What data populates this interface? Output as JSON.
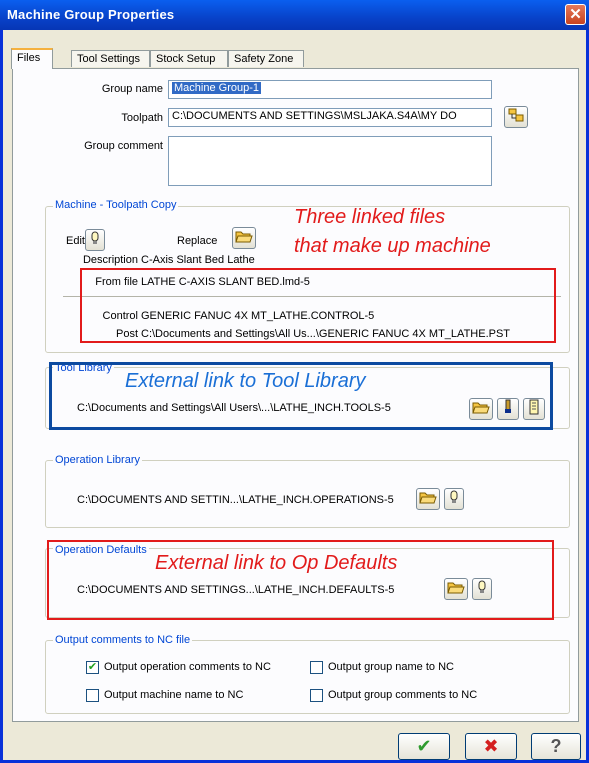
{
  "window": {
    "title": "Machine Group Properties",
    "close_glyph": "✕"
  },
  "tabs": [
    "Files",
    "Tool Settings",
    "Stock Setup",
    "Safety Zone"
  ],
  "form": {
    "group_name_label": "Group name",
    "group_name_value": "Machine Group-1",
    "toolpath_label": "Toolpath",
    "toolpath_value": "C:\\DOCUMENTS AND SETTINGS\\MSLJAKA.S4A\\MY DO",
    "group_comment_label": "Group comment",
    "group_comment_value": ""
  },
  "machine_toolpath": {
    "title": "Machine - Toolpath Copy",
    "edit_label": "Edit",
    "replace_label": "Replace",
    "description_label": "Description",
    "description_value": "C-Axis Slant Bed Lathe",
    "from_file_label": "From file",
    "from_file_value": "LATHE C-AXIS SLANT BED.lmd-5",
    "control_label": "Control",
    "control_value": "GENERIC FANUC 4X MT_LATHE.CONTROL-5",
    "post_label": "Post",
    "post_value": "C:\\Documents and Settings\\All Us...\\GENERIC FANUC 4X MT_LATHE.PST"
  },
  "tool_library": {
    "title": "Tool Library",
    "path": "C:\\Documents and Settings\\All Users\\...\\LATHE_INCH.TOOLS-5"
  },
  "operation_library": {
    "title": "Operation Library",
    "path": "C:\\DOCUMENTS AND SETTIN...\\LATHE_INCH.OPERATIONS-5"
  },
  "operation_defaults": {
    "title": "Operation Defaults",
    "path": "C:\\DOCUMENTS AND SETTINGS...\\LATHE_INCH.DEFAULTS-5"
  },
  "output_comments": {
    "title": "Output comments to NC file",
    "options": [
      {
        "label": "Output operation comments to NC",
        "checked": true
      },
      {
        "label": "Output group name to NC",
        "checked": false
      },
      {
        "label": "Output machine name to NC",
        "checked": false
      },
      {
        "label": "Output group comments to NC",
        "checked": false
      }
    ]
  },
  "annotations": {
    "machine_line1": "Three linked files",
    "machine_line2": "that make up machine",
    "tool_library": "External link to Tool Library",
    "op_defaults": "External link to Op Defaults"
  },
  "footer": {
    "ok_glyph": "✔",
    "cancel_glyph": "✖",
    "help_glyph": "?"
  },
  "colors": {
    "title_bar": "#0842C9",
    "annotation_red": "#E21B1B",
    "annotation_blue": "#0C4AA0",
    "group_label": "#0046D5"
  }
}
